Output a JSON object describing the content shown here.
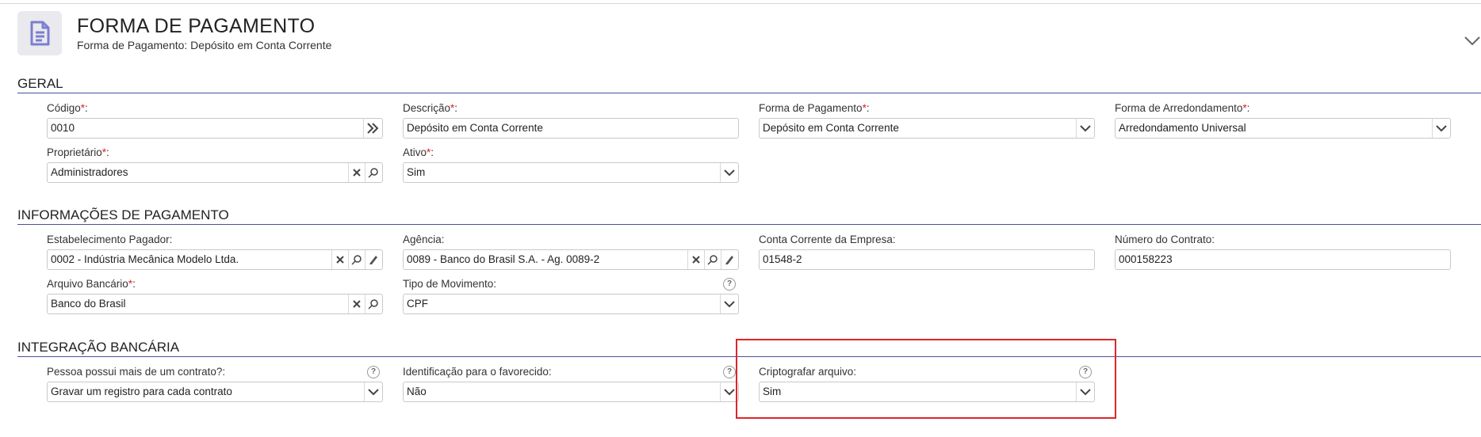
{
  "header": {
    "title": "FORMA DE PAGAMENTO",
    "subtitle": "Forma de Pagamento: Depósito em Conta Corrente",
    "icon": "document-icon",
    "collapse_icon": "chevron-down-icon"
  },
  "sections": {
    "geral": "GERAL",
    "informacoes": "INFORMAÇÕES DE PAGAMENTO",
    "integracao": "INTEGRAÇÃO BANCÁRIA"
  },
  "fields": {
    "codigo": {
      "label": "Código",
      "required": "*",
      "colon": ":",
      "value": "0010"
    },
    "descricao": {
      "label": "Descrição",
      "required": "*",
      "colon": ":",
      "value": "Depósito em Conta Corrente"
    },
    "forma_pagamento": {
      "label": "Forma de Pagamento",
      "required": "*",
      "colon": ":",
      "value": "Depósito em Conta Corrente"
    },
    "forma_arredondamento": {
      "label": "Forma de Arredondamento",
      "required": "*",
      "colon": ":",
      "value": "Arredondamento Universal"
    },
    "proprietario": {
      "label": "Proprietário",
      "required": "*",
      "colon": ":",
      "value": "Administradores"
    },
    "ativo": {
      "label": "Ativo",
      "required": "*",
      "colon": ":",
      "value": "Sim"
    },
    "estabelecimento": {
      "label": "Estabelecimento Pagador:",
      "value": "0002 - Indústria Mecânica Modelo Ltda."
    },
    "agencia": {
      "label": "Agência:",
      "value": "0089 - Banco do Brasil S.A. - Ag. 0089-2"
    },
    "conta_corrente": {
      "label": "Conta Corrente da Empresa:",
      "value": "01548-2"
    },
    "numero_contrato": {
      "label": "Número do Contrato:",
      "value": "000158223"
    },
    "arquivo_bancario": {
      "label": "Arquivo Bancário",
      "required": "*",
      "colon": ":",
      "value": "Banco do Brasil"
    },
    "tipo_movimento": {
      "label": "Tipo de Movimento:",
      "value": "CPF"
    },
    "pessoa_contrato": {
      "label": "Pessoa possui mais de um contrato?:",
      "value": "Gravar um registro para cada contrato"
    },
    "identificacao": {
      "label": "Identificação para o favorecido:",
      "value": "Não"
    },
    "criptografar": {
      "label": "Criptografar arquivo:",
      "value": "Sim"
    }
  },
  "help_glyph": "?"
}
